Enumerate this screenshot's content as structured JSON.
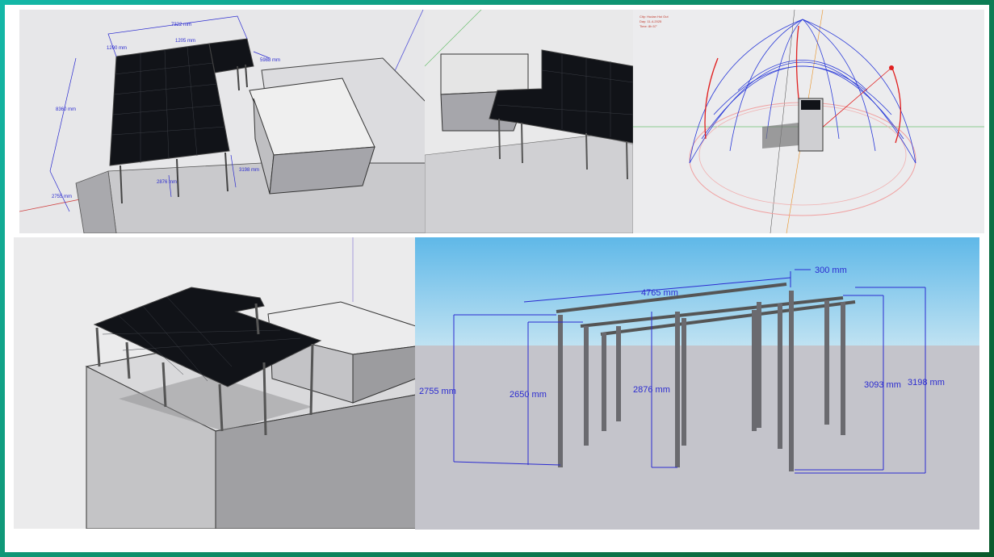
{
  "panels": {
    "top_left": {
      "dimensions": {
        "total_width": "7322 mm",
        "panel_a": "1200 mm",
        "panel_b": "1205 mm",
        "right_depth": "5988 mm",
        "length": "8360 mm",
        "front_height": "2755 mm",
        "mid_height": "2876 mm",
        "right_height": "3198 mm"
      }
    },
    "top_right": {
      "info": {
        "city": "City: Hudan Hoi Out",
        "date": "Day: 11-4-2025",
        "time": "Time: 8h 57'"
      }
    },
    "bottom_right": {
      "dimensions": {
        "span": "4765 mm",
        "overhang": "300 mm",
        "h1": "2755 mm",
        "h2": "2650 mm",
        "h3": "2876 mm",
        "h4": "3093 mm",
        "h5": "3198 mm"
      }
    }
  },
  "colors": {
    "dimension": "#2b2bd0",
    "panel": "#111318",
    "sky_top": "#5fb8e8",
    "ground": "#c4c4cb",
    "sun_path_red": "#e02020",
    "sun_grid_blue": "#2a3ad8",
    "frame_gradient_start": "#14b8a8",
    "frame_gradient_end": "#0a5a2c"
  }
}
